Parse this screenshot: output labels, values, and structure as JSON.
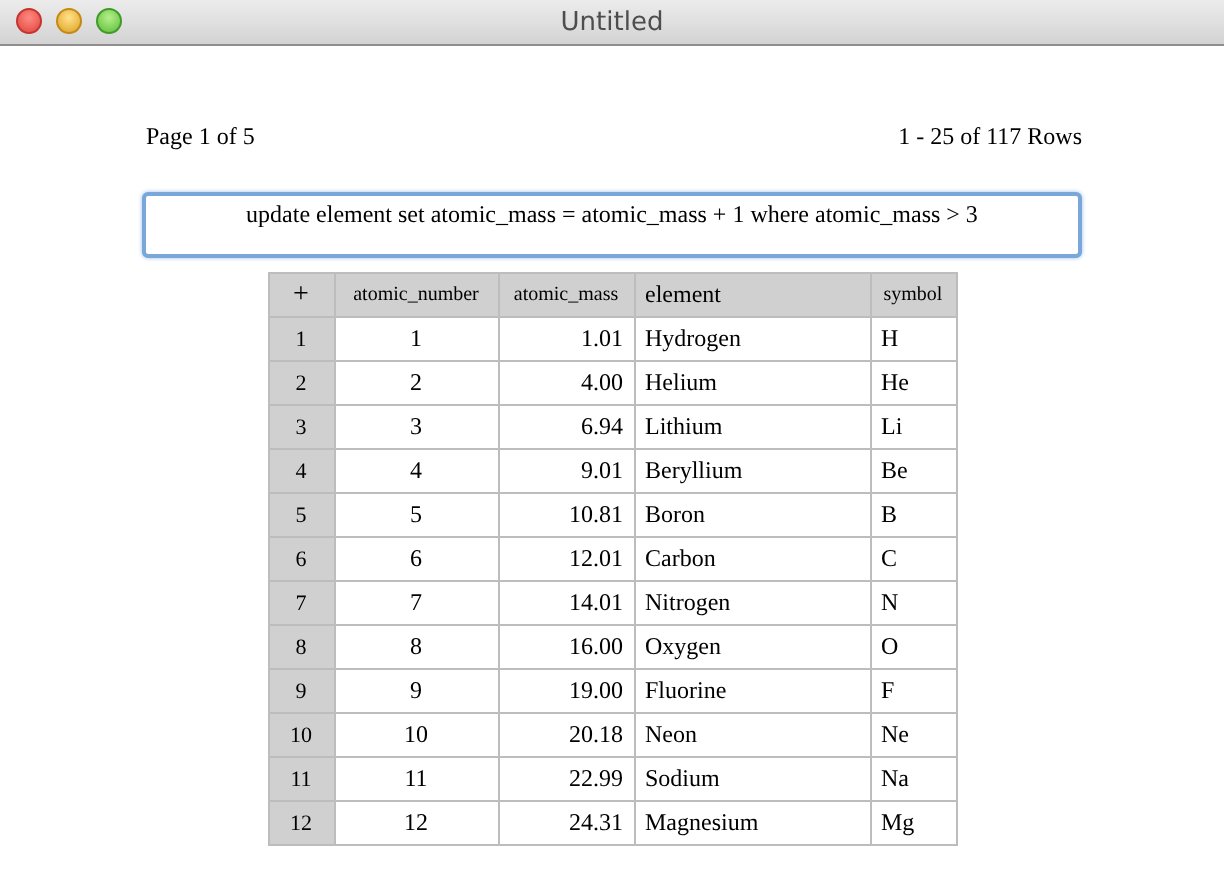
{
  "window": {
    "title": "Untitled"
  },
  "pager": {
    "page": "Page 1 of 5",
    "rows": "1 - 25 of 117 Rows"
  },
  "query": {
    "value": "update element set atomic_mass = atomic_mass + 1 where atomic_mass > 3"
  },
  "table": {
    "add_label": "+",
    "columns": [
      "atomic_number",
      "atomic_mass",
      "element",
      "symbol"
    ],
    "rows": [
      {
        "index": "1",
        "cells": [
          "1",
          "1.01",
          "Hydrogen",
          "H"
        ]
      },
      {
        "index": "2",
        "cells": [
          "2",
          "4.00",
          "Helium",
          "He"
        ]
      },
      {
        "index": "3",
        "cells": [
          "3",
          "6.94",
          "Lithium",
          "Li"
        ]
      },
      {
        "index": "4",
        "cells": [
          "4",
          "9.01",
          "Beryllium",
          "Be"
        ]
      },
      {
        "index": "5",
        "cells": [
          "5",
          "10.81",
          "Boron",
          "B"
        ]
      },
      {
        "index": "6",
        "cells": [
          "6",
          "12.01",
          "Carbon",
          "C"
        ]
      },
      {
        "index": "7",
        "cells": [
          "7",
          "14.01",
          "Nitrogen",
          "N"
        ]
      },
      {
        "index": "8",
        "cells": [
          "8",
          "16.00",
          "Oxygen",
          "O"
        ]
      },
      {
        "index": "9",
        "cells": [
          "9",
          "19.00",
          "Fluorine",
          "F"
        ]
      },
      {
        "index": "10",
        "cells": [
          "10",
          "20.18",
          "Neon",
          "Ne"
        ]
      },
      {
        "index": "11",
        "cells": [
          "11",
          "22.99",
          "Sodium",
          "Na"
        ]
      },
      {
        "index": "12",
        "cells": [
          "12",
          "24.31",
          "Magnesium",
          "Mg"
        ]
      }
    ]
  }
}
